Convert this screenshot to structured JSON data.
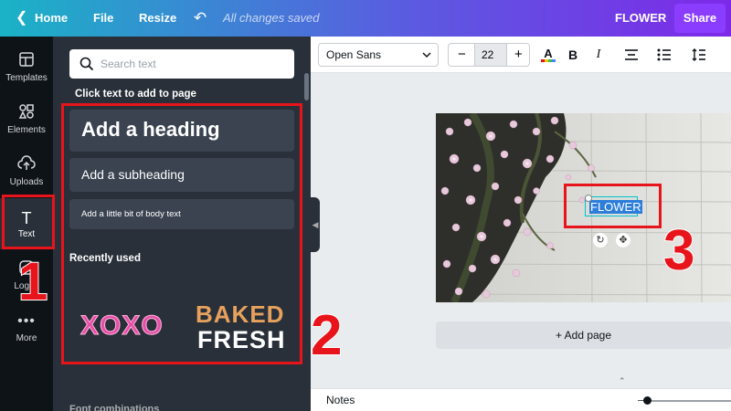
{
  "topbar": {
    "home_label": "Home",
    "file_label": "File",
    "resize_label": "Resize",
    "saved_status": "All changes saved",
    "design_title": "FLOWER",
    "share_label": "Share"
  },
  "leftnav": {
    "items": [
      {
        "label": "Templates",
        "icon": "templates-icon"
      },
      {
        "label": "Elements",
        "icon": "elements-icon"
      },
      {
        "label": "Uploads",
        "icon": "uploads-icon"
      },
      {
        "label": "Text",
        "icon": "text-icon"
      },
      {
        "label": "Logos",
        "icon": "logos-icon"
      },
      {
        "label": "More",
        "icon": "more-icon"
      }
    ],
    "active": "Text"
  },
  "panel": {
    "search_placeholder": "Search text",
    "hint": "Click text to add to page",
    "add_heading": "Add a heading",
    "add_subheading": "Add a subheading",
    "add_body": "Add a little bit of body text",
    "recently_used": "Recently used",
    "recent_1": "XOXO",
    "recent_2_line1": "BAKED",
    "recent_2_line2": "FRESH",
    "font_combinations": "Font combinations"
  },
  "toolbar": {
    "font_family": "Open Sans",
    "font_size": "22"
  },
  "canvas": {
    "selected_text": "FLOWER",
    "add_page_label": "+ Add page",
    "notes_label": "Notes"
  },
  "annotations": {
    "step_1": "1",
    "step_2": "2",
    "step_3": "3"
  },
  "colors": {
    "accent": "#7d2ae8",
    "annotation_red": "#e8141b",
    "panel_bg": "#293039",
    "nav_bg": "#0e1318"
  }
}
